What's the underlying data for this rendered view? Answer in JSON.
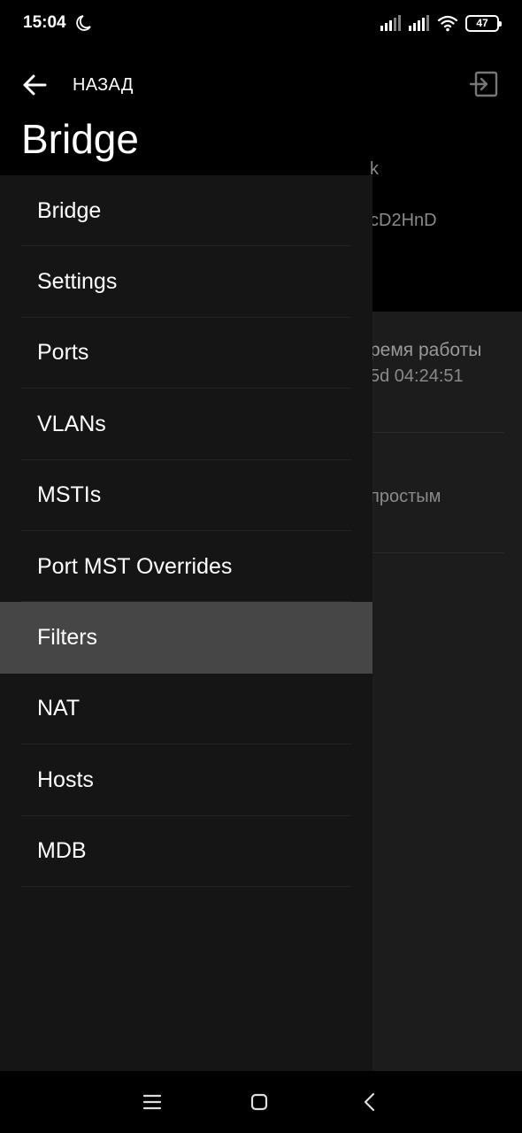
{
  "status_bar": {
    "time": "15:04",
    "battery": "47",
    "icons": [
      "moon-icon",
      "signal-icon",
      "signal-icon",
      "wifi-icon",
      "battery-icon"
    ]
  },
  "header": {
    "back_label": "НАЗАД",
    "title": "Bridge"
  },
  "background": {
    "text_1": "k",
    "text_2": "cD2HnD",
    "text_3": "ремя работы",
    "text_4": "5d 04:24:51",
    "text_5": "простым"
  },
  "menu": {
    "items": [
      {
        "label": "Bridge"
      },
      {
        "label": "Settings"
      },
      {
        "label": "Ports"
      },
      {
        "label": "VLANs"
      },
      {
        "label": "MSTIs"
      },
      {
        "label": "Port MST Overrides"
      },
      {
        "label": "Filters"
      },
      {
        "label": "NAT"
      },
      {
        "label": "Hosts"
      },
      {
        "label": "MDB"
      }
    ],
    "active": "Filters"
  },
  "nav_bar": {
    "icons": [
      "menu-icon",
      "home-icon",
      "back-icon"
    ]
  },
  "colors": {
    "drawer_bg": "#151515",
    "active_item_bg": "#464646",
    "background_content": "#1c1c1c"
  }
}
